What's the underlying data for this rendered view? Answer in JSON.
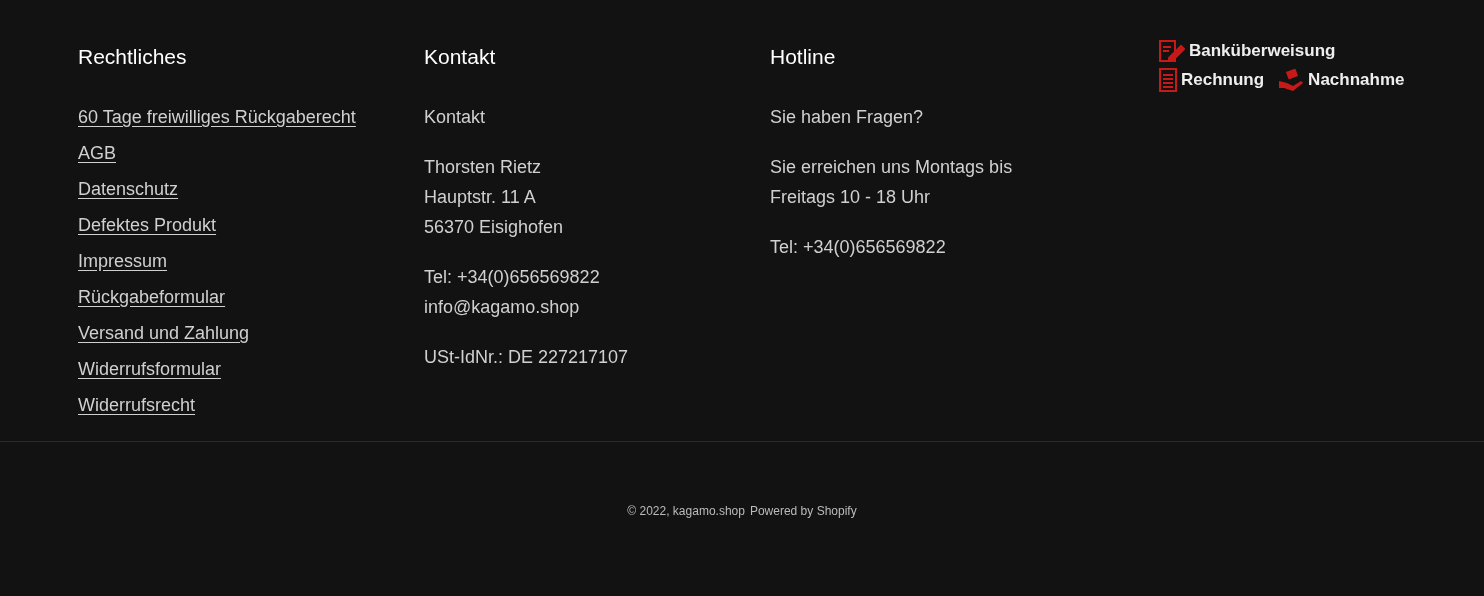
{
  "columns": [
    {
      "heading": "Rechtliches",
      "links": [
        "60 Tage freiwilliges Rückgaberecht",
        "AGB",
        "Datenschutz",
        "Defektes Produkt",
        "Impressum",
        "Rückgabeformular",
        "Versand und Zahlung",
        "Widerrufsformular",
        "Widerrufsrecht"
      ]
    },
    {
      "heading": "Kontakt",
      "paragraphs": [
        [
          "Kontakt"
        ],
        [
          "Thorsten Rietz",
          "Hauptstr. 11 A",
          "56370 Eisighofen"
        ],
        [
          "Tel: +34(0)656569822",
          "info@kagamo.shop"
        ],
        [
          "USt-IdNr.: DE 227217107"
        ]
      ]
    },
    {
      "heading": "Hotline",
      "paragraphs": [
        [
          "Sie haben Fragen?"
        ],
        [
          "Sie erreichen uns Montags bis",
          "Freitags 10 - 18 Uhr"
        ],
        [
          "Tel: +34(0)656569822"
        ]
      ]
    }
  ],
  "payment_methods": [
    [
      {
        "kind": "transfer",
        "label": "Banküberweisung"
      }
    ],
    [
      {
        "kind": "invoice",
        "label": "Rechnung"
      },
      {
        "kind": "cod",
        "label": "Nachnahme"
      }
    ]
  ],
  "copyright": "© 2022, kagamo.shop",
  "powered_by": "Powered by Shopify"
}
